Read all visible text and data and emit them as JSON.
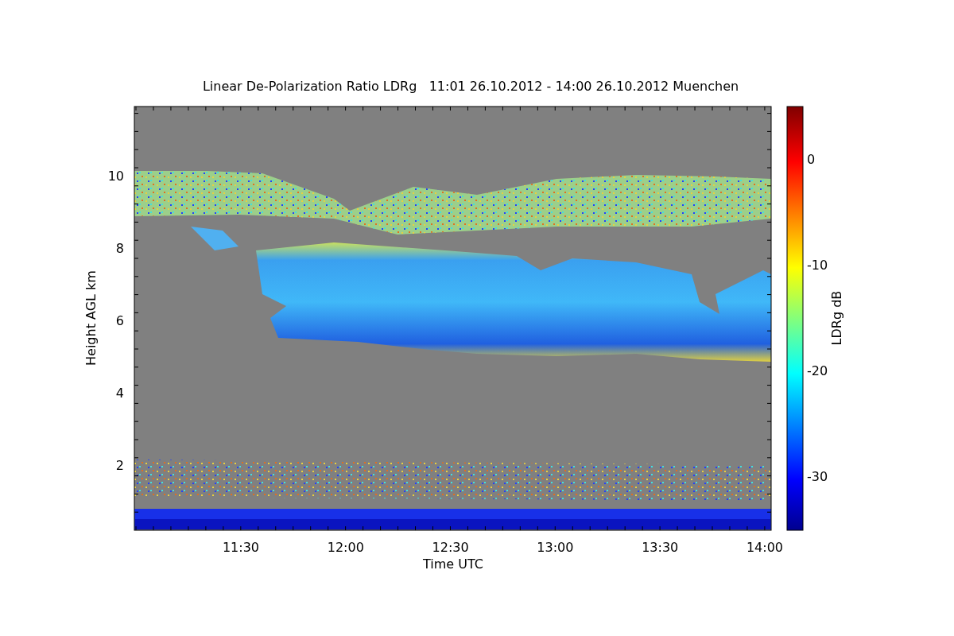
{
  "title": "Linear De-Polarization Ratio LDRg   11:01 26.10.2012 - 14:00 26.10.2012 Muenchen",
  "plot": {
    "ylabel": "Height AGL km",
    "xlabel": "Time UTC",
    "yticks": [
      "10",
      "8",
      "6",
      "4",
      "2"
    ],
    "xticks": [
      "11:30",
      "12:00",
      "12:30",
      "13:00",
      "13:30",
      "14:00"
    ]
  },
  "colorbar": {
    "label": "LDRg dB",
    "ticks": [
      "0",
      "-10",
      "-20",
      "-30"
    ]
  }
}
